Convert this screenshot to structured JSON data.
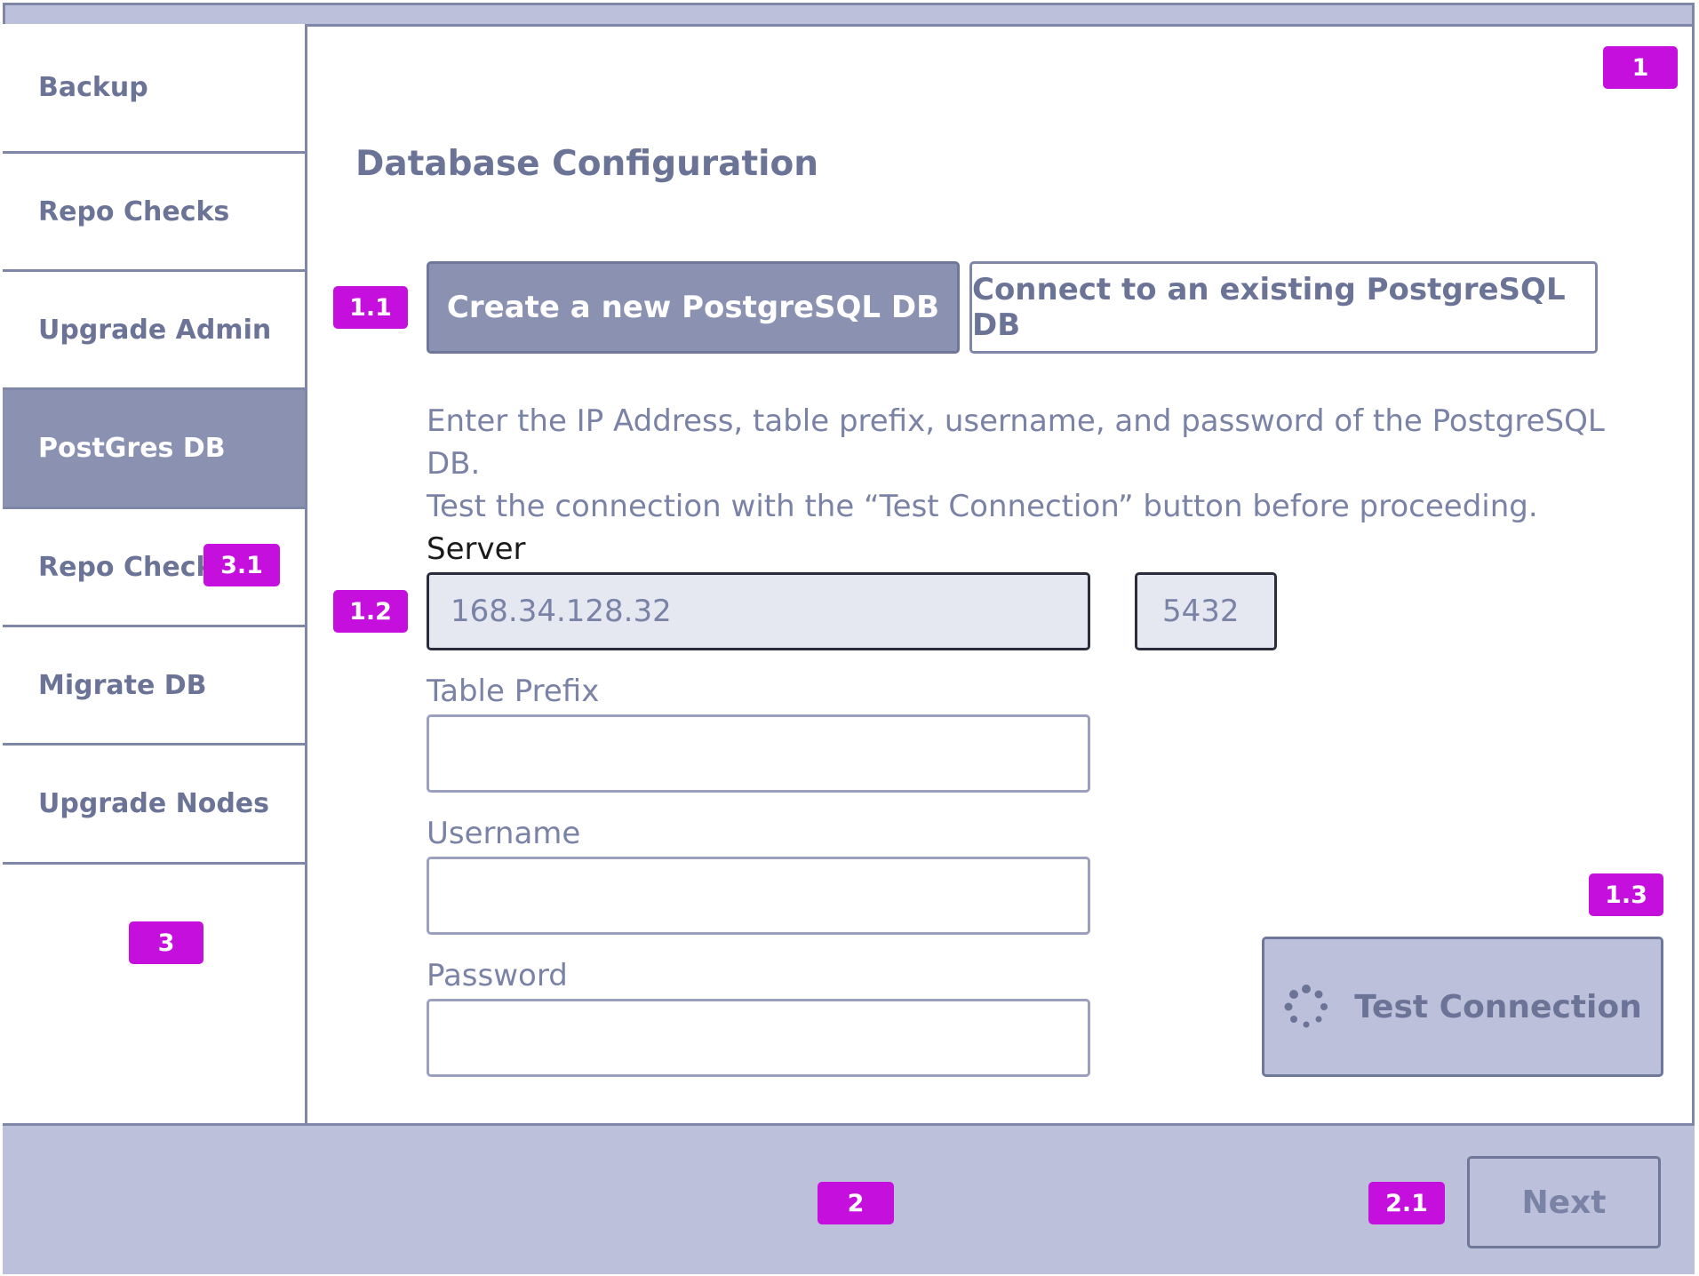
{
  "sidebar": {
    "items": [
      {
        "label": "Backup"
      },
      {
        "label": "Repo Checks"
      },
      {
        "label": "Upgrade Admin"
      },
      {
        "label": "PostGres DB",
        "active": true
      },
      {
        "label": "Repo Checks"
      },
      {
        "label": "Migrate DB"
      },
      {
        "label": "Upgrade Nodes"
      }
    ]
  },
  "badges": {
    "main": "1",
    "db_mode": "1.1",
    "server": "1.2",
    "test": "1.3",
    "footer": "2",
    "next": "2.1",
    "sidebar": "3",
    "sidebar_item": "3.1"
  },
  "main": {
    "title": "Database Configuration",
    "db_mode": {
      "create_label": "Create a new PostgreSQL DB",
      "connect_label": "Connect to an existing PostgreSQL DB",
      "selected": "create"
    },
    "instructions_line1": "Enter the IP Address, table prefix, username, and password of the PostgreSQL DB.",
    "instructions_line2": "Test the connection with the “Test Connection” button before proceeding.",
    "server": {
      "label": "Server",
      "host_value": "168.34.128.32",
      "port_value": "5432"
    },
    "table_prefix": {
      "label": "Table Prefix",
      "value": ""
    },
    "username": {
      "label": "Username",
      "value": ""
    },
    "password": {
      "label": "Password",
      "value": ""
    },
    "test_button": {
      "label": "Test Connection",
      "icon": "spinner-icon"
    }
  },
  "footer": {
    "next_label": "Next"
  },
  "colors": {
    "accent_badge": "#c40fdd",
    "active_fill": "#8a91b1",
    "panel_fill": "#bcc0db",
    "text": "#6b7496"
  }
}
